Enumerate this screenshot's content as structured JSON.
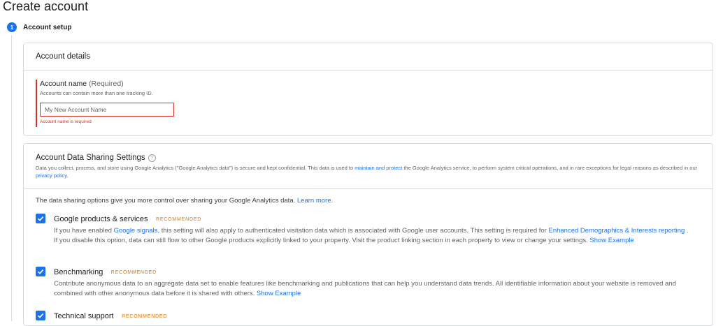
{
  "page": {
    "title": "Create account"
  },
  "step": {
    "number": "1",
    "label": "Account setup"
  },
  "account_details": {
    "header": "Account details",
    "name_label": "Account name",
    "required": "(Required)",
    "help": "Accounts can contain more than one tracking ID.",
    "placeholder": "My New Account Name",
    "value": "",
    "error": "Account name is required"
  },
  "sharing": {
    "header": "Account Data Sharing Settings",
    "help_icon": "?",
    "desc_before": "Data you collect, process, and store using Google Analytics (\"Google Analytics data\") is secure and kept confidential. This data is used to ",
    "desc_link": "maintain and protect",
    "desc_mid": " the Google Analytics service, to perform system critical operations, and in rare exceptions for legal reasons as described in our ",
    "desc_link2": "privacy policy",
    "desc_end": ".",
    "intro": "The data sharing options give you more control over sharing your Google Analytics data.",
    "intro_link": "Learn more.",
    "options": [
      {
        "title": "Google products & services",
        "badge": "RECOMMENDED",
        "checked": true,
        "desc_a": "If you have enabled ",
        "link_a": "Google signals",
        "desc_b": ", this setting will also apply to authenticated visitation data which is associated with Google user accounts. This setting is required for ",
        "link_b": "Enhanced Demographics & Interests reporting",
        "desc_c": " . If you disable this option, data can still flow to other Google products explicitly linked to your property. Visit the product linking section in each property to view or change your settings.",
        "link_c": "Show Example"
      },
      {
        "title": "Benchmarking",
        "badge": "RECOMMENDED",
        "checked": true,
        "desc_a": "Contribute anonymous data to an aggregate data set to enable features like benchmarking and publications that can help you understand data trends. All identifiable information about your website is removed and combined with other anonymous data before it is shared with others.",
        "link_c": "Show Example"
      },
      {
        "title": "Technical support",
        "badge": "RECOMMENDED",
        "checked": true
      }
    ]
  },
  "colors": {
    "accent": "#1a73e8",
    "error": "#d93025",
    "badge": "#e37400"
  }
}
